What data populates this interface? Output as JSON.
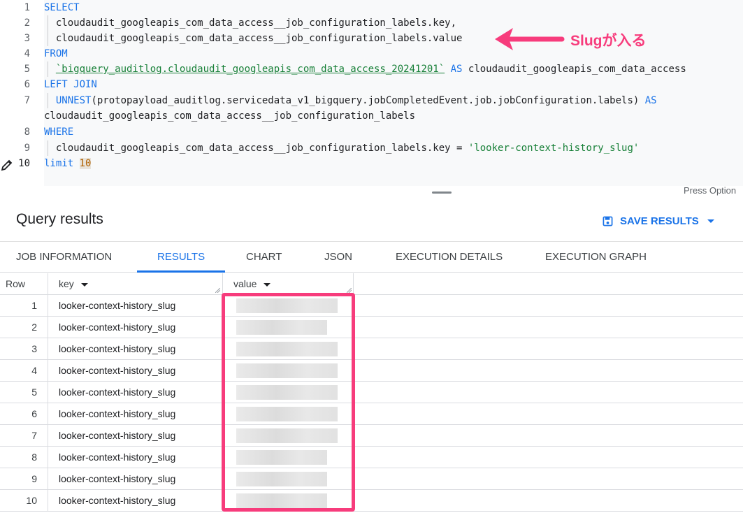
{
  "editor": {
    "line_numbers": [
      "1",
      "2",
      "3",
      "4",
      "5",
      "6",
      "7",
      "",
      "8",
      "9",
      "10"
    ],
    "lines": {
      "l1_kw": "SELECT",
      "l2": "  cloudaudit_googleapis_com_data_access__job_configuration_labels.key,",
      "l3": "  cloudaudit_googleapis_com_data_access__job_configuration_labels.value",
      "l4_kw": "FROM",
      "l5_table": "`bigquery_auditlog.cloudaudit_googleapis_com_data_access_20241201`",
      "l5_as": "AS",
      "l5_alias": "cloudaudit_googleapis_com_data_access",
      "l6_kw": "LEFT JOIN",
      "l7_fn": "UNNEST",
      "l7_arg": "(protopayload_auditlog.servicedata_v1_bigquery.jobCompletedEvent.job.jobConfiguration.labels)",
      "l7_as": "AS",
      "l7b": "cloudaudit_googleapis_com_data_access__job_configuration_labels",
      "l8_kw": "WHERE",
      "l9": "  cloudaudit_googleapis_com_data_access__job_configuration_labels.key = ",
      "l9_str": "'looker-context-history_slug'",
      "l10_kw": "limit",
      "l10_num": "10"
    },
    "press_hint": "Press Option"
  },
  "annotation": {
    "text": "Slugが入る",
    "color": "#f73c7c"
  },
  "results": {
    "title": "Query results",
    "save_label": "SAVE RESULTS",
    "tabs": [
      "JOB INFORMATION",
      "RESULTS",
      "CHART",
      "JSON",
      "EXECUTION DETAILS",
      "EXECUTION GRAPH"
    ],
    "active_tab": "RESULTS",
    "columns": [
      "Row",
      "key",
      "value"
    ],
    "rows": [
      {
        "n": "1",
        "key": "looker-context-history_slug"
      },
      {
        "n": "2",
        "key": "looker-context-history_slug"
      },
      {
        "n": "3",
        "key": "looker-context-history_slug"
      },
      {
        "n": "4",
        "key": "looker-context-history_slug"
      },
      {
        "n": "5",
        "key": "looker-context-history_slug"
      },
      {
        "n": "6",
        "key": "looker-context-history_slug"
      },
      {
        "n": "7",
        "key": "looker-context-history_slug"
      },
      {
        "n": "8",
        "key": "looker-context-history_slug"
      },
      {
        "n": "9",
        "key": "looker-context-history_slug"
      },
      {
        "n": "10",
        "key": "looker-context-history_slug"
      }
    ]
  },
  "colors": {
    "accent": "#1a73e8",
    "keyword": "#1a73e8",
    "string": "#188038",
    "highlight": "#f73c7c"
  }
}
